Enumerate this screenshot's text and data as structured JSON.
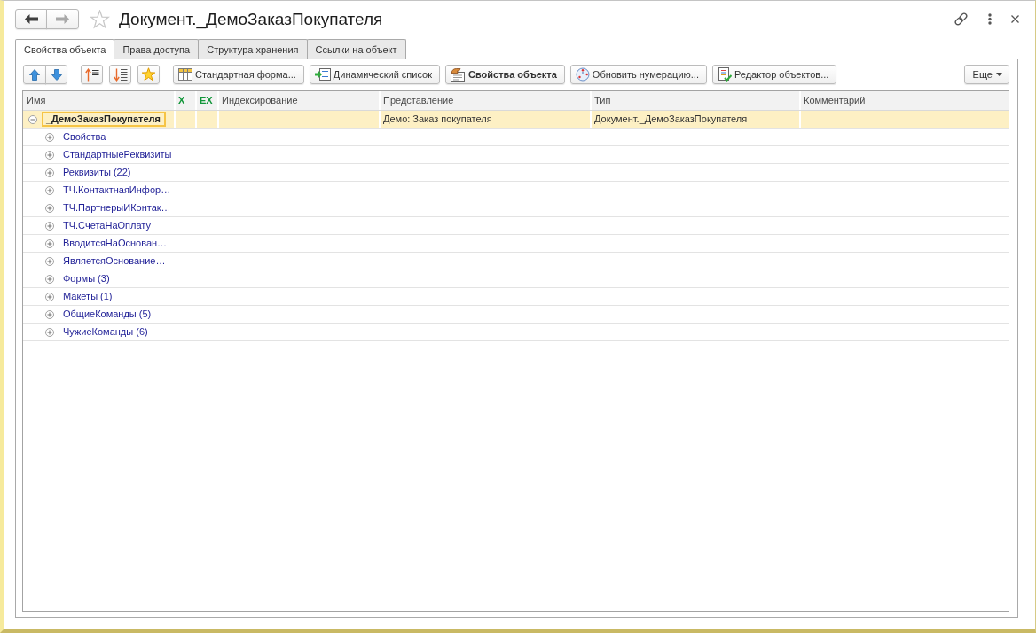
{
  "window": {
    "title": "Документ._ДемоЗаказПокупателя",
    "favorite": false
  },
  "navigation": {
    "back": {
      "disabled": false
    },
    "forward": {
      "disabled": true
    }
  },
  "tabs": [
    {
      "label": "Свойства объекта",
      "selected": true
    },
    {
      "label": "Права доступа",
      "selected": false
    },
    {
      "label": "Структура хранения",
      "selected": false
    },
    {
      "label": "Ссылки на объект",
      "selected": false
    }
  ],
  "toolbar": {
    "buttons": [
      {
        "label": "Стандартная форма...",
        "default": false
      },
      {
        "label": "Динамический список",
        "default": false
      },
      {
        "label": "Свойства объекта",
        "default": true
      },
      {
        "label": "Обновить нумерацию...",
        "default": false
      },
      {
        "label": "Редактор объектов...",
        "default": false
      }
    ],
    "more": {
      "label": "Еще"
    }
  },
  "table": {
    "columns": [
      {
        "label": "Имя",
        "kind": "text"
      },
      {
        "label": "X",
        "kind": "flag"
      },
      {
        "label": "EX",
        "kind": "flag"
      },
      {
        "label": "Индексирование",
        "kind": "text"
      },
      {
        "label": "Представление",
        "kind": "text"
      },
      {
        "label": "Тип",
        "kind": "text"
      },
      {
        "label": "Комментарий",
        "kind": "text"
      }
    ],
    "rows": [
      {
        "name": "_ДемоЗаказПокупателя",
        "presentation": "Демо: Заказ покупателя",
        "type": "Документ._ДемоЗаказПокупателя",
        "selected": true,
        "expanded": true,
        "children": [
          {
            "name": "Свойства",
            "selected": false,
            "expanded": false
          },
          {
            "name": "СтандартныеРеквизиты",
            "selected": false,
            "expanded": false
          },
          {
            "name": "Реквизиты (22)",
            "selected": false,
            "expanded": false
          },
          {
            "name": "ТЧ.КонтактнаяИнфор…",
            "selected": false,
            "expanded": false
          },
          {
            "name": "ТЧ.ПартнерыИКонтак…",
            "selected": false,
            "expanded": false
          },
          {
            "name": "ТЧ.СчетаНаОплату",
            "selected": false,
            "expanded": false
          },
          {
            "name": "ВводитсяНаОснован…",
            "selected": false,
            "expanded": false
          },
          {
            "name": "ЯвляетсяОснование…",
            "selected": false,
            "expanded": false
          },
          {
            "name": "Формы (3)",
            "selected": false,
            "expanded": false
          },
          {
            "name": "Макеты (1)",
            "selected": false,
            "expanded": false
          },
          {
            "name": "ОбщиеКоманды (5)",
            "selected": false,
            "expanded": false
          },
          {
            "name": "ЧужиеКоманды (6)",
            "selected": false,
            "expanded": false
          }
        ]
      }
    ]
  }
}
